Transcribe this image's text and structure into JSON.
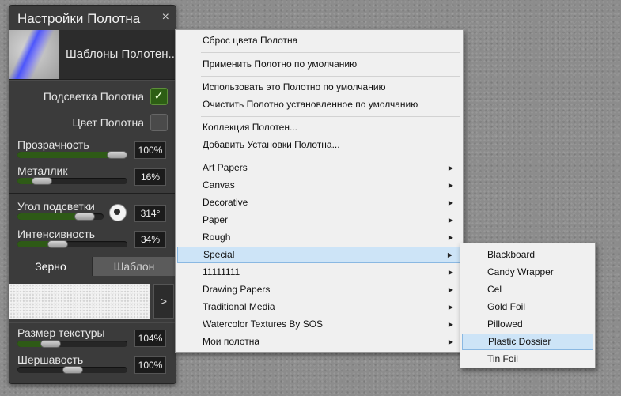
{
  "panel": {
    "title": "Настройки Полотна",
    "close_icon": "×",
    "preset_label": "Шаблоны Полотен...",
    "canvas_lighting_label": "Подсветка Полотна",
    "canvas_lighting_check": "✓",
    "canvas_color_label": "Цвет Полотна",
    "opacity": {
      "label": "Прозрачность",
      "value_text": "100%",
      "value": 100
    },
    "metallic": {
      "label": "Металлик",
      "value_text": "16%",
      "value": 16
    },
    "light_angle": {
      "label": "Угол подсветки",
      "value_text": "314°",
      "value": 314
    },
    "intensity": {
      "label": "Интенсивность",
      "value_text": "34%",
      "value": 34
    },
    "tab_grain": "Зерно",
    "tab_pattern": "Шаблон",
    "grain_arrow": ">",
    "texture_size": {
      "label": "Размер текстуры",
      "value_text": "104%",
      "value": 104
    },
    "roughness": {
      "label": "Шершавость",
      "value_text": "100%",
      "value": 100
    }
  },
  "menu": {
    "items": [
      "Сброс цвета Полотна",
      "Применить Полотно по умолчанию",
      "Использовать это Полотно по умолчанию",
      "Очистить Полотно установленное по умолчанию",
      "Коллекция Полотен...",
      "Добавить Установки Полотна...",
      "Art Papers",
      "Canvas",
      "Decorative",
      "Paper",
      "Rough",
      "Special",
      "11111111",
      "Drawing Papers",
      "Traditional Media",
      "Watercolor Textures By SOS",
      "Мои полотна"
    ],
    "submenu_arrow": "▶",
    "highlighted": "Special"
  },
  "submenu": {
    "items": [
      "Blackboard",
      "Candy Wrapper",
      "Cel",
      "Gold Foil",
      "Pillowed",
      "Plastic Dossier",
      "Tin Foil"
    ],
    "highlighted": "Plastic Dossier"
  },
  "colors": {
    "accent_green": "#2e5a16",
    "menu_highlight": "#cde4f7",
    "panel_bg": "#3b3b3b"
  }
}
